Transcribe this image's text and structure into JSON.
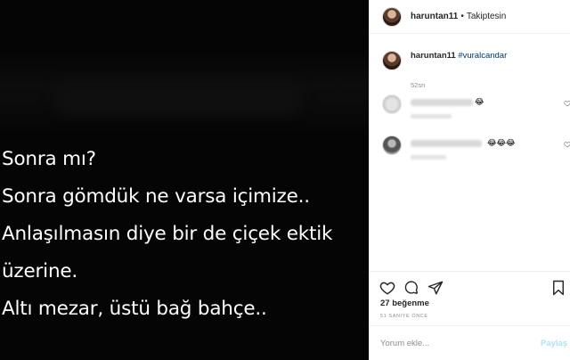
{
  "post": {
    "lines": [
      "Sonra mı?",
      "Sonra gömdük ne varsa içimize..",
      "Anlaşılmasın diye bir de çiçek ektik",
      "üzerine.",
      "Altı mezar, üstü bağ bahçe.."
    ]
  },
  "header": {
    "username": "haruntan11",
    "separator": "•",
    "follow_status": "Takiptesin"
  },
  "caption": {
    "username": "haruntan11",
    "hashtag": "#vuralcandar",
    "time": "52sn"
  },
  "comments": [
    {
      "emoji": "😂"
    },
    {
      "emoji": "😂😂😂"
    }
  ],
  "actions": {
    "icons": [
      "heart-icon",
      "comment-icon",
      "share-icon",
      "bookmark-icon"
    ]
  },
  "likes": "27 beğenme",
  "age": "51 SANIYE ÖNCE",
  "compose": {
    "placeholder": "Yorum ekle...",
    "send_label": "Paylaş"
  },
  "colors": {
    "image_bg": "#050505",
    "text_primary": "#262626",
    "text_secondary": "#8e8e8e",
    "hashtag": "#00376b",
    "send_disabled": "#b2dffc",
    "border": "#efefef"
  }
}
